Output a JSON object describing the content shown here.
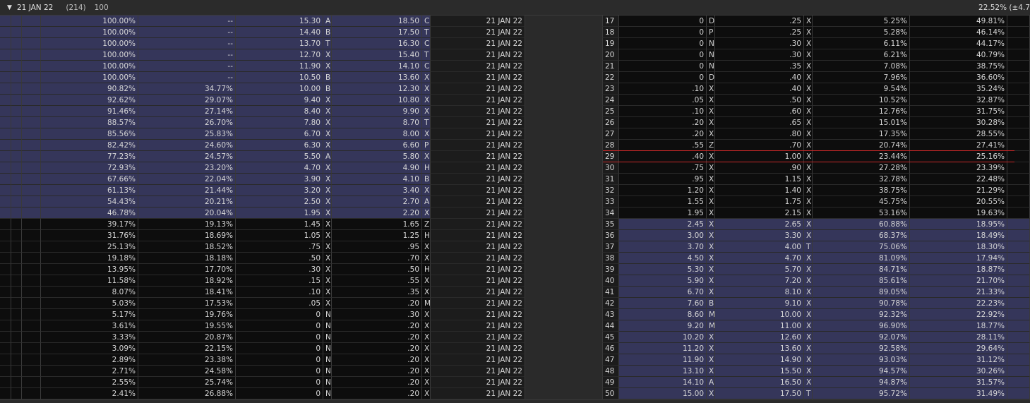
{
  "header": {
    "expiration": "21 JAN 22",
    "count": "(214)",
    "strikes_shown": "100",
    "iv_readout": "22.52% (±4.7"
  },
  "colors": {
    "itm_shade": "#35365a",
    "otm_shade": "#0d0d0d",
    "atm_line": "#c62828"
  },
  "atm_after_strike": "28",
  "rows": [
    {
      "cprob": "100.00%",
      "civ": "--",
      "cbid": "15.30",
      "cbx": "A",
      "cask": "18.50",
      "cax": "C",
      "exp": "21 JAN 22",
      "strike": "17",
      "pbid": "0",
      "pbx": "D",
      "pask": ".25",
      "pax": "X",
      "pprob": "5.25%",
      "piv": "49.81%"
    },
    {
      "cprob": "100.00%",
      "civ": "--",
      "cbid": "14.40",
      "cbx": "B",
      "cask": "17.50",
      "cax": "T",
      "exp": "21 JAN 22",
      "strike": "18",
      "pbid": "0",
      "pbx": "P",
      "pask": ".25",
      "pax": "X",
      "pprob": "5.28%",
      "piv": "46.14%"
    },
    {
      "cprob": "100.00%",
      "civ": "--",
      "cbid": "13.70",
      "cbx": "T",
      "cask": "16.30",
      "cax": "C",
      "exp": "21 JAN 22",
      "strike": "19",
      "pbid": "0",
      "pbx": "N",
      "pask": ".30",
      "pax": "X",
      "pprob": "6.11%",
      "piv": "44.17%"
    },
    {
      "cprob": "100.00%",
      "civ": "--",
      "cbid": "12.70",
      "cbx": "X",
      "cask": "15.40",
      "cax": "T",
      "exp": "21 JAN 22",
      "strike": "20",
      "pbid": "0",
      "pbx": "N",
      "pask": ".30",
      "pax": "X",
      "pprob": "6.21%",
      "piv": "40.79%"
    },
    {
      "cprob": "100.00%",
      "civ": "--",
      "cbid": "11.90",
      "cbx": "X",
      "cask": "14.10",
      "cax": "C",
      "exp": "21 JAN 22",
      "strike": "21",
      "pbid": "0",
      "pbx": "N",
      "pask": ".35",
      "pax": "X",
      "pprob": "7.08%",
      "piv": "38.75%"
    },
    {
      "cprob": "100.00%",
      "civ": "--",
      "cbid": "10.50",
      "cbx": "B",
      "cask": "13.60",
      "cax": "X",
      "exp": "21 JAN 22",
      "strike": "22",
      "pbid": "0",
      "pbx": "D",
      "pask": ".40",
      "pax": "X",
      "pprob": "7.96%",
      "piv": "36.60%"
    },
    {
      "cprob": "90.82%",
      "civ": "34.77%",
      "cbid": "10.00",
      "cbx": "B",
      "cask": "12.30",
      "cax": "X",
      "exp": "21 JAN 22",
      "strike": "23",
      "pbid": ".10",
      "pbx": "X",
      "pask": ".40",
      "pax": "X",
      "pprob": "9.54%",
      "piv": "35.24%"
    },
    {
      "cprob": "92.62%",
      "civ": "29.07%",
      "cbid": "9.40",
      "cbx": "X",
      "cask": "10.80",
      "cax": "X",
      "exp": "21 JAN 22",
      "strike": "24",
      "pbid": ".05",
      "pbx": "X",
      "pask": ".50",
      "pax": "X",
      "pprob": "10.52%",
      "piv": "32.87%"
    },
    {
      "cprob": "91.46%",
      "civ": "27.14%",
      "cbid": "8.40",
      "cbx": "X",
      "cask": "9.90",
      "cax": "X",
      "exp": "21 JAN 22",
      "strike": "25",
      "pbid": ".10",
      "pbx": "X",
      "pask": ".60",
      "pax": "X",
      "pprob": "12.76%",
      "piv": "31.75%"
    },
    {
      "cprob": "88.57%",
      "civ": "26.70%",
      "cbid": "7.80",
      "cbx": "X",
      "cask": "8.70",
      "cax": "T",
      "exp": "21 JAN 22",
      "strike": "26",
      "pbid": ".20",
      "pbx": "X",
      "pask": ".65",
      "pax": "X",
      "pprob": "15.01%",
      "piv": "30.28%"
    },
    {
      "cprob": "85.56%",
      "civ": "25.83%",
      "cbid": "6.70",
      "cbx": "X",
      "cask": "8.00",
      "cax": "X",
      "exp": "21 JAN 22",
      "strike": "27",
      "pbid": ".20",
      "pbx": "X",
      "pask": ".80",
      "pax": "X",
      "pprob": "17.35%",
      "piv": "28.55%"
    },
    {
      "cprob": "82.42%",
      "civ": "24.60%",
      "cbid": "6.30",
      "cbx": "X",
      "cask": "6.60",
      "cax": "P",
      "exp": "21 JAN 22",
      "strike": "28",
      "pbid": ".55",
      "pbx": "Z",
      "pask": ".70",
      "pax": "X",
      "pprob": "20.74%",
      "piv": "27.41%"
    },
    {
      "cprob": "77.23%",
      "civ": "24.57%",
      "cbid": "5.50",
      "cbx": "A",
      "cask": "5.80",
      "cax": "X",
      "exp": "21 JAN 22",
      "strike": "29",
      "pbid": ".40",
      "pbx": "X",
      "pask": "1.00",
      "pax": "X",
      "pprob": "23.44%",
      "piv": "25.16%"
    },
    {
      "cprob": "72.93%",
      "civ": "23.20%",
      "cbid": "4.70",
      "cbx": "X",
      "cask": "4.90",
      "cax": "H",
      "exp": "21 JAN 22",
      "strike": "30",
      "pbid": ".75",
      "pbx": "X",
      "pask": ".90",
      "pax": "X",
      "pprob": "27.28%",
      "piv": "23.39%"
    },
    {
      "cprob": "67.66%",
      "civ": "22.04%",
      "cbid": "3.90",
      "cbx": "X",
      "cask": "4.10",
      "cax": "B",
      "exp": "21 JAN 22",
      "strike": "31",
      "pbid": ".95",
      "pbx": "X",
      "pask": "1.15",
      "pax": "X",
      "pprob": "32.78%",
      "piv": "22.48%"
    },
    {
      "cprob": "61.13%",
      "civ": "21.44%",
      "cbid": "3.20",
      "cbx": "X",
      "cask": "3.40",
      "cax": "X",
      "exp": "21 JAN 22",
      "strike": "32",
      "pbid": "1.20",
      "pbx": "X",
      "pask": "1.40",
      "pax": "X",
      "pprob": "38.75%",
      "piv": "21.29%"
    },
    {
      "cprob": "54.43%",
      "civ": "20.21%",
      "cbid": "2.50",
      "cbx": "X",
      "cask": "2.70",
      "cax": "A",
      "exp": "21 JAN 22",
      "strike": "33",
      "pbid": "1.55",
      "pbx": "X",
      "pask": "1.75",
      "pax": "X",
      "pprob": "45.75%",
      "piv": "20.55%"
    },
    {
      "cprob": "46.78%",
      "civ": "20.04%",
      "cbid": "1.95",
      "cbx": "X",
      "cask": "2.20",
      "cax": "X",
      "exp": "21 JAN 22",
      "strike": "34",
      "pbid": "1.95",
      "pbx": "X",
      "pask": "2.15",
      "pax": "X",
      "pprob": "53.16%",
      "piv": "19.63%"
    },
    {
      "cprob": "39.17%",
      "civ": "19.13%",
      "cbid": "1.45",
      "cbx": "X",
      "cask": "1.65",
      "cax": "Z",
      "exp": "21 JAN 22",
      "strike": "35",
      "pbid": "2.45",
      "pbx": "X",
      "pask": "2.65",
      "pax": "X",
      "pprob": "60.88%",
      "piv": "18.95%"
    },
    {
      "cprob": "31.76%",
      "civ": "18.69%",
      "cbid": "1.05",
      "cbx": "X",
      "cask": "1.25",
      "cax": "H",
      "exp": "21 JAN 22",
      "strike": "36",
      "pbid": "3.00",
      "pbx": "X",
      "pask": "3.30",
      "pax": "X",
      "pprob": "68.37%",
      "piv": "18.49%"
    },
    {
      "cprob": "25.13%",
      "civ": "18.52%",
      "cbid": ".75",
      "cbx": "X",
      "cask": ".95",
      "cax": "X",
      "exp": "21 JAN 22",
      "strike": "37",
      "pbid": "3.70",
      "pbx": "X",
      "pask": "4.00",
      "pax": "T",
      "pprob": "75.06%",
      "piv": "18.30%"
    },
    {
      "cprob": "19.18%",
      "civ": "18.18%",
      "cbid": ".50",
      "cbx": "X",
      "cask": ".70",
      "cax": "X",
      "exp": "21 JAN 22",
      "strike": "38",
      "pbid": "4.50",
      "pbx": "X",
      "pask": "4.70",
      "pax": "X",
      "pprob": "81.09%",
      "piv": "17.94%"
    },
    {
      "cprob": "13.95%",
      "civ": "17.70%",
      "cbid": ".30",
      "cbx": "X",
      "cask": ".50",
      "cax": "H",
      "exp": "21 JAN 22",
      "strike": "39",
      "pbid": "5.30",
      "pbx": "X",
      "pask": "5.70",
      "pax": "X",
      "pprob": "84.71%",
      "piv": "18.87%"
    },
    {
      "cprob": "11.58%",
      "civ": "18.92%",
      "cbid": ".15",
      "cbx": "X",
      "cask": ".55",
      "cax": "X",
      "exp": "21 JAN 22",
      "strike": "40",
      "pbid": "5.90",
      "pbx": "X",
      "pask": "7.20",
      "pax": "X",
      "pprob": "85.61%",
      "piv": "21.70%"
    },
    {
      "cprob": "8.07%",
      "civ": "18.41%",
      "cbid": ".10",
      "cbx": "X",
      "cask": ".35",
      "cax": "X",
      "exp": "21 JAN 22",
      "strike": "41",
      "pbid": "6.70",
      "pbx": "X",
      "pask": "8.10",
      "pax": "X",
      "pprob": "89.05%",
      "piv": "21.33%"
    },
    {
      "cprob": "5.03%",
      "civ": "17.53%",
      "cbid": ".05",
      "cbx": "X",
      "cask": ".20",
      "cax": "M",
      "exp": "21 JAN 22",
      "strike": "42",
      "pbid": "7.60",
      "pbx": "B",
      "pask": "9.10",
      "pax": "X",
      "pprob": "90.78%",
      "piv": "22.23%"
    },
    {
      "cprob": "5.17%",
      "civ": "19.76%",
      "cbid": "0",
      "cbx": "N",
      "cask": ".30",
      "cax": "X",
      "exp": "21 JAN 22",
      "strike": "43",
      "pbid": "8.60",
      "pbx": "M",
      "pask": "10.00",
      "pax": "X",
      "pprob": "92.32%",
      "piv": "22.92%"
    },
    {
      "cprob": "3.61%",
      "civ": "19.55%",
      "cbid": "0",
      "cbx": "N",
      "cask": ".20",
      "cax": "X",
      "exp": "21 JAN 22",
      "strike": "44",
      "pbid": "9.20",
      "pbx": "M",
      "pask": "11.00",
      "pax": "X",
      "pprob": "96.90%",
      "piv": "18.77%"
    },
    {
      "cprob": "3.33%",
      "civ": "20.87%",
      "cbid": "0",
      "cbx": "N",
      "cask": ".20",
      "cax": "X",
      "exp": "21 JAN 22",
      "strike": "45",
      "pbid": "10.20",
      "pbx": "X",
      "pask": "12.60",
      "pax": "X",
      "pprob": "92.07%",
      "piv": "28.11%"
    },
    {
      "cprob": "3.09%",
      "civ": "22.15%",
      "cbid": "0",
      "cbx": "N",
      "cask": ".20",
      "cax": "X",
      "exp": "21 JAN 22",
      "strike": "46",
      "pbid": "11.20",
      "pbx": "X",
      "pask": "13.60",
      "pax": "X",
      "pprob": "92.58%",
      "piv": "29.64%"
    },
    {
      "cprob": "2.89%",
      "civ": "23.38%",
      "cbid": "0",
      "cbx": "N",
      "cask": ".20",
      "cax": "X",
      "exp": "21 JAN 22",
      "strike": "47",
      "pbid": "11.90",
      "pbx": "X",
      "pask": "14.90",
      "pax": "X",
      "pprob": "93.03%",
      "piv": "31.12%"
    },
    {
      "cprob": "2.71%",
      "civ": "24.58%",
      "cbid": "0",
      "cbx": "N",
      "cask": ".20",
      "cax": "X",
      "exp": "21 JAN 22",
      "strike": "48",
      "pbid": "13.10",
      "pbx": "X",
      "pask": "15.50",
      "pax": "X",
      "pprob": "94.57%",
      "piv": "30.26%"
    },
    {
      "cprob": "2.55%",
      "civ": "25.74%",
      "cbid": "0",
      "cbx": "N",
      "cask": ".20",
      "cax": "X",
      "exp": "21 JAN 22",
      "strike": "49",
      "pbid": "14.10",
      "pbx": "A",
      "pask": "16.50",
      "pax": "X",
      "pprob": "94.87%",
      "piv": "31.57%"
    },
    {
      "cprob": "2.41%",
      "civ": "26.88%",
      "cbid": "0",
      "cbx": "N",
      "cask": ".20",
      "cax": "X",
      "exp": "21 JAN 22",
      "strike": "50",
      "pbid": "15.00",
      "pbx": "X",
      "pask": "17.50",
      "pax": "T",
      "pprob": "95.72%",
      "piv": "31.49%"
    }
  ]
}
